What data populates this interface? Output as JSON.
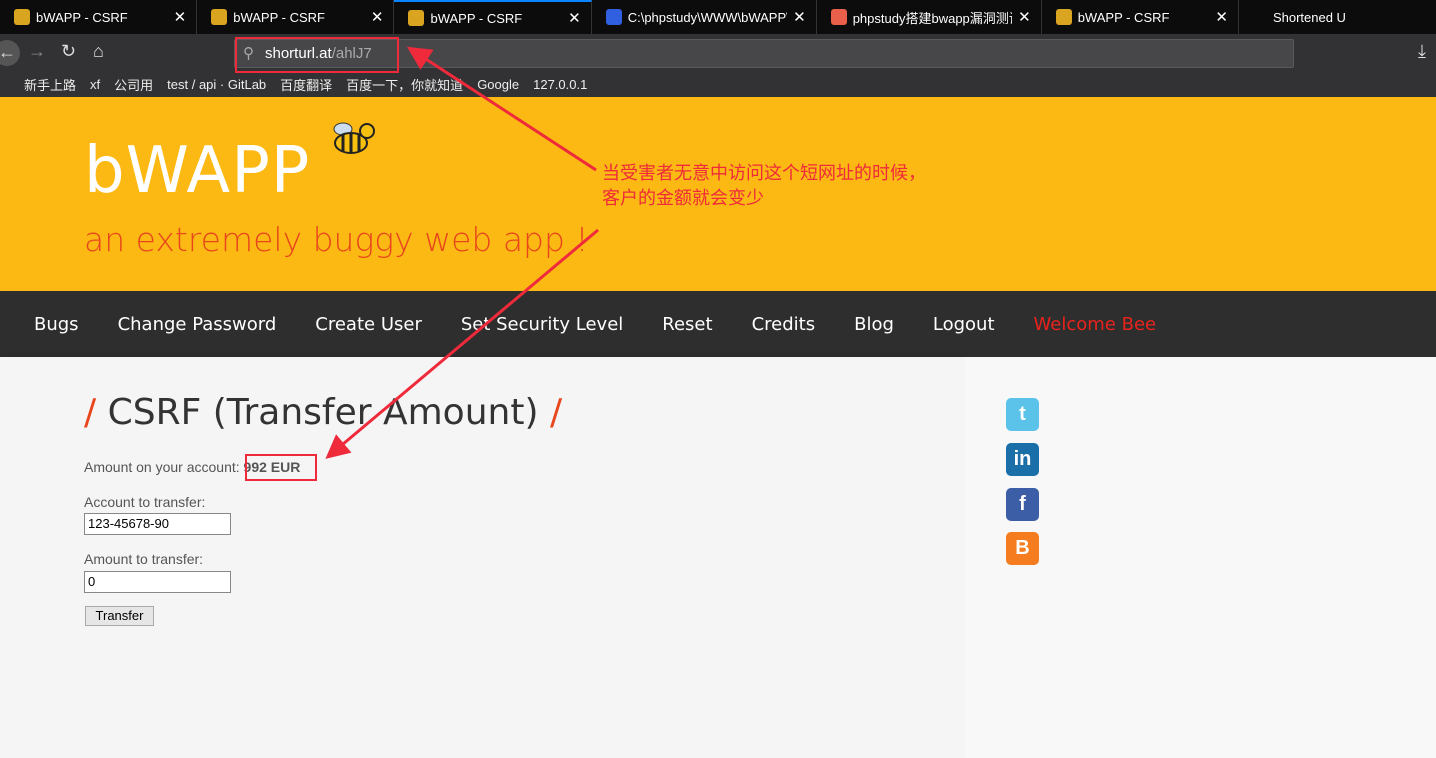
{
  "tabs": [
    {
      "title": "bWAPP - CSRF",
      "icon": "bee-icon"
    },
    {
      "title": "bWAPP - CSRF",
      "icon": "bee-icon"
    },
    {
      "title": "bWAPP - CSRF",
      "icon": "bee-icon",
      "active": true
    },
    {
      "title": "C:\\phpstudy\\WWW\\bWAPP\\",
      "icon": "baidu-icon"
    },
    {
      "title": "phpstudy搭建bwapp漏洞测试",
      "icon": "jianshu-icon"
    },
    {
      "title": "bWAPP - CSRF",
      "icon": "bee-icon"
    },
    {
      "title": "Shortened U"
    }
  ],
  "url": {
    "host": "shorturl.at",
    "path": "/ahlJ7"
  },
  "bookmarks": [
    "新手上路",
    "xf",
    "公司用",
    "test / api · GitLab",
    "百度翻译",
    "百度一下，你就知道",
    "Google",
    "127.0.0.1"
  ],
  "header": {
    "logo": "bWAPP",
    "tagline": "an extremely buggy web app !"
  },
  "annotation": {
    "line1": "当受害者无意中访问这个短网址的时候，",
    "line2": "客户的金额就会变少",
    "color": "#ee2a3b"
  },
  "nav": [
    "Bugs",
    "Change Password",
    "Create User",
    "Set Security Level",
    "Reset",
    "Credits",
    "Blog",
    "Logout",
    "Welcome Bee"
  ],
  "page": {
    "title": "CSRF (Transfer Amount)",
    "slash": "/",
    "amount_label": "Amount on your account:",
    "amount": "992 EUR",
    "account_label": "Account to transfer:",
    "account_value": "123-45678-90",
    "amount_transfer_label": "Amount to transfer:",
    "amount_transfer_value": "0",
    "button": "Transfer"
  },
  "social": [
    "twitter-icon",
    "linkedin-icon",
    "facebook-icon",
    "blogger-icon"
  ],
  "colors": {
    "header": "#fdb913",
    "accent": "#e8461c",
    "nav": "#2e2e2e"
  }
}
